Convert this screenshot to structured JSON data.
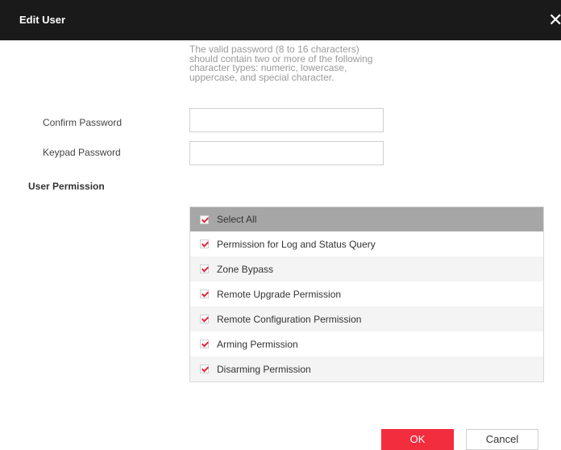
{
  "dialog": {
    "title": "Edit User",
    "close_symbol": "✕"
  },
  "password_hint": "The valid password (8 to 16 characters) should contain two or more of the following character types: numeric, lowercase, uppercase, and special character.",
  "fields": {
    "confirm_password": {
      "label": "Confirm Password",
      "value": "",
      "placeholder": ""
    },
    "keypad_password": {
      "label": "Keypad Password",
      "value": "",
      "placeholder": ""
    }
  },
  "permissions": {
    "section_title": "User Permission",
    "select_all": {
      "label": "Select All",
      "checked": true
    },
    "items": [
      {
        "label": "Permission for Log and Status Query",
        "checked": true
      },
      {
        "label": "Zone Bypass",
        "checked": true
      },
      {
        "label": "Remote Upgrade Permission",
        "checked": true
      },
      {
        "label": "Remote Configuration Permission",
        "checked": true
      },
      {
        "label": "Arming Permission",
        "checked": true
      },
      {
        "label": "Disarming Permission",
        "checked": true
      }
    ]
  },
  "buttons": {
    "ok": "OK",
    "cancel": "Cancel"
  },
  "colors": {
    "title_bar": "#1a1a1a",
    "accent": "#f12d3e",
    "check": "#e0273a",
    "header_row": "#a6a6a6"
  }
}
